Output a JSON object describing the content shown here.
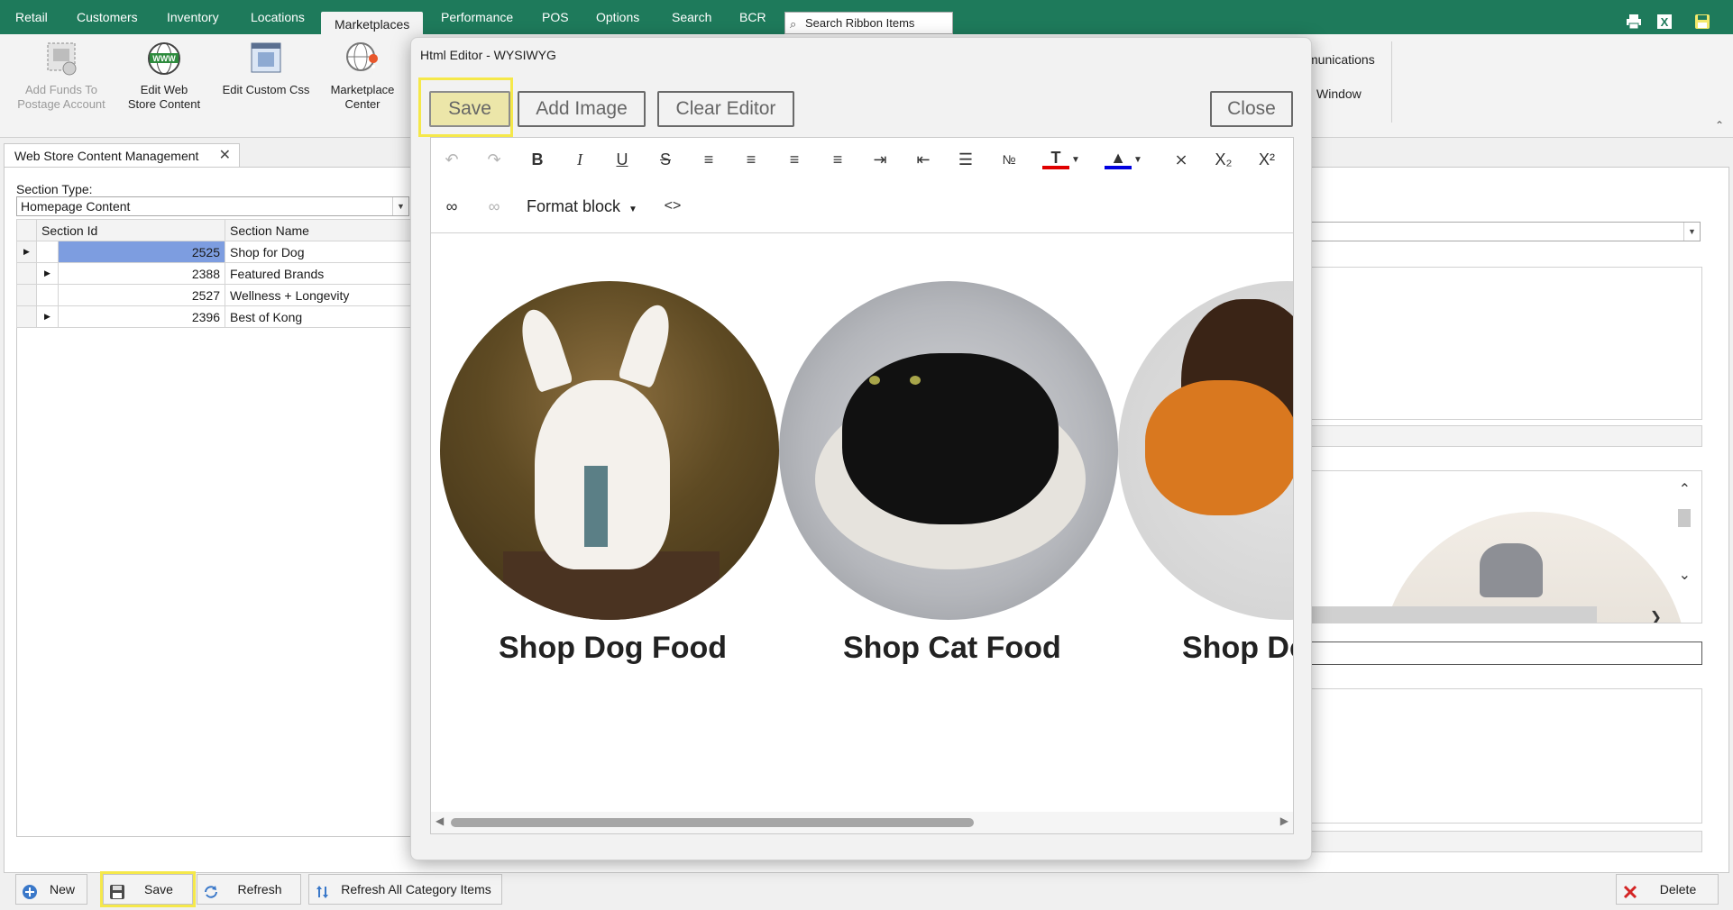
{
  "ribbon": {
    "tabs": [
      "Retail",
      "Customers",
      "Inventory",
      "Locations",
      "Marketplaces",
      "Performance",
      "POS",
      "Options",
      "Search",
      "BCR"
    ],
    "active_tab": "Marketplaces",
    "search_placeholder": "Search Ribbon Items",
    "buttons": {
      "add_funds": "Add Funds To Postage Account",
      "add_funds_l1": "Add Funds To",
      "add_funds_l2": "Postage Account",
      "edit_web_l1": "Edit Web",
      "edit_web_l2": "Store Content",
      "edit_css": "Edit Custom Css",
      "marketplace_l1": "Marketplace",
      "marketplace_l2": "Center"
    },
    "partial_communications": "munications",
    "partial_window": "Window"
  },
  "doc_tab": {
    "label": "Web Store Content Management"
  },
  "left_panel": {
    "section_type_label": "Section Type:",
    "section_type_value": "Homepage Content",
    "columns": [
      "Section Id",
      "Section Name"
    ],
    "rows": [
      {
        "id": "2525",
        "name": "Shop for Dog",
        "expandable": false,
        "selected": true
      },
      {
        "id": "2388",
        "name": "Featured Brands",
        "expandable": true,
        "selected": false
      },
      {
        "id": "2527",
        "name": "Wellness + Longevity",
        "expandable": false,
        "selected": false
      },
      {
        "id": "2396",
        "name": "Best of Kong",
        "expandable": true,
        "selected": false
      }
    ]
  },
  "bottom_bar": {
    "new": "New",
    "save": "Save",
    "refresh": "Refresh",
    "refresh_all": "Refresh All Category Items",
    "delete": "Delete"
  },
  "dialog": {
    "title": "Html Editor - WYSIWYG",
    "save": "Save",
    "add_image": "Add Image",
    "clear_editor": "Clear Editor",
    "close": "Close",
    "format_block": "Format block",
    "captions": [
      "Shop Dog Food",
      "Shop Cat Food",
      "Shop Do"
    ]
  },
  "colors": {
    "ribbon_green": "#1e7a5b",
    "highlight": "#f5e84a",
    "selected_row": "#7d9de0",
    "text_color_red": "#e00000",
    "fill_color_blue": "#0000e0"
  }
}
